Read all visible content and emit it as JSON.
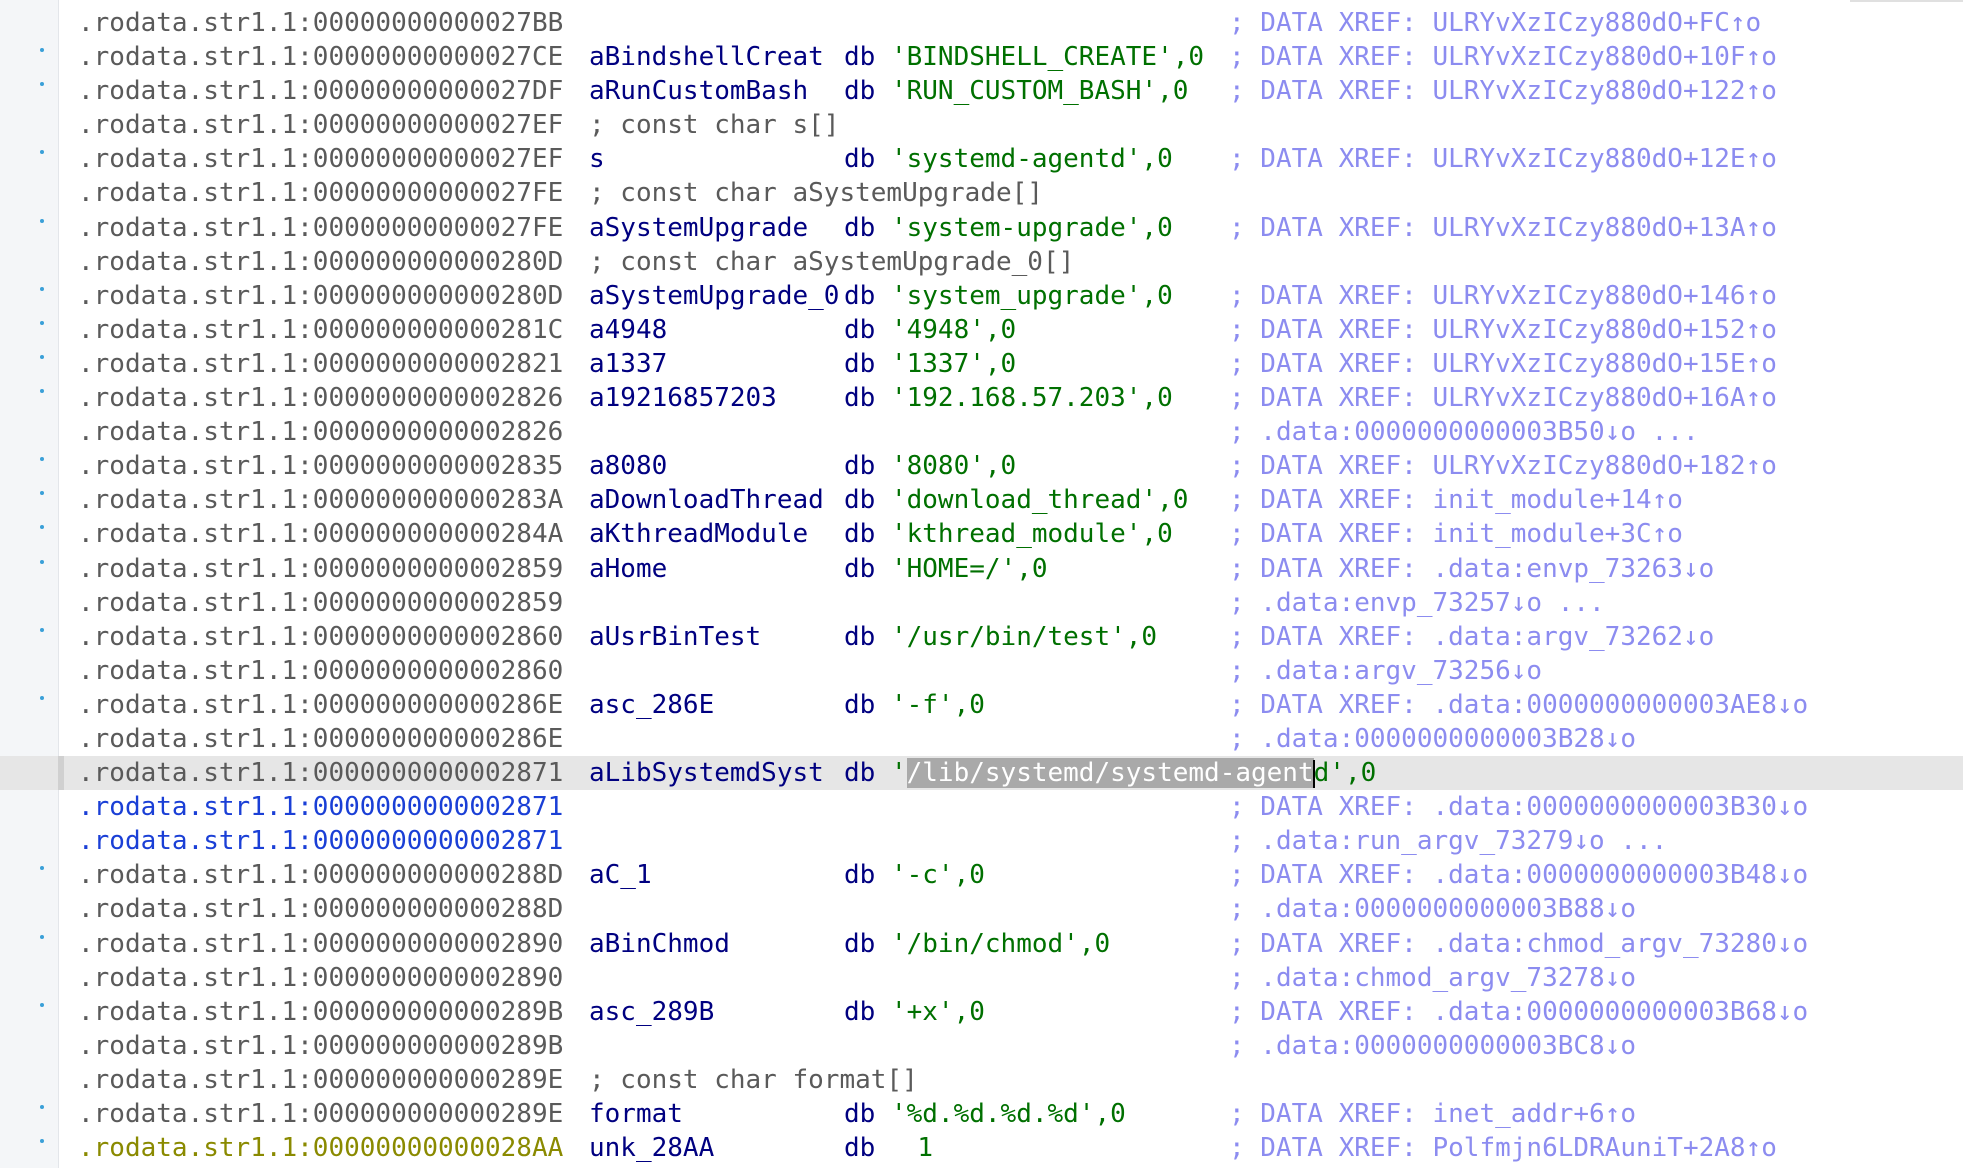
{
  "lines": [
    {
      "dot": false,
      "seg": ".rodata.str1.1:00000000000027BB",
      "segStyle": "",
      "name": "",
      "op": "",
      "str": "",
      "tail": "",
      "cmt": "; DATA XREF: ULRYvXzICzy880dO+FC↑o"
    },
    {
      "dot": true,
      "seg": ".rodata.str1.1:00000000000027CE",
      "segStyle": "",
      "name": "aBindshellCreat",
      "op": "db ",
      "str": "'BINDSHELL_CREATE'",
      "tail": ",0",
      "cmt": "; DATA XREF: ULRYvXzICzy880dO+10F↑o"
    },
    {
      "dot": true,
      "seg": ".rodata.str1.1:00000000000027DF",
      "segStyle": "",
      "name": "aRunCustomBash",
      "op": "db ",
      "str": "'RUN_CUSTOM_BASH'",
      "tail": ",0",
      "cmt": "; DATA XREF: ULRYvXzICzy880dO+122↑o"
    },
    {
      "dot": false,
      "seg": ".rodata.str1.1:00000000000027EF",
      "segStyle": "",
      "name": "; const char s[]",
      "nameComment": true,
      "op": "",
      "str": "",
      "tail": "",
      "cmt": ""
    },
    {
      "dot": true,
      "seg": ".rodata.str1.1:00000000000027EF",
      "segStyle": "",
      "name": "s",
      "op": "db ",
      "str": "'systemd-agentd'",
      "tail": ",0",
      "cmt": "; DATA XREF: ULRYvXzICzy880dO+12E↑o"
    },
    {
      "dot": false,
      "seg": ".rodata.str1.1:00000000000027FE",
      "segStyle": "",
      "name": "; const char aSystemUpgrade[]",
      "nameComment": true,
      "op": "",
      "str": "",
      "tail": "",
      "cmt": ""
    },
    {
      "dot": true,
      "seg": ".rodata.str1.1:00000000000027FE",
      "segStyle": "",
      "name": "aSystemUpgrade",
      "op": "db ",
      "str": "'system-upgrade'",
      "tail": ",0",
      "cmt": "; DATA XREF: ULRYvXzICzy880dO+13A↑o"
    },
    {
      "dot": false,
      "seg": ".rodata.str1.1:000000000000280D",
      "segStyle": "",
      "name": "; const char aSystemUpgrade_0[]",
      "nameComment": true,
      "op": "",
      "str": "",
      "tail": "",
      "cmt": ""
    },
    {
      "dot": true,
      "seg": ".rodata.str1.1:000000000000280D",
      "segStyle": "",
      "name": "aSystemUpgrade_0",
      "op": "db ",
      "str": "'system_upgrade'",
      "tail": ",0",
      "cmt": "; DATA XREF: ULRYvXzICzy880dO+146↑o"
    },
    {
      "dot": true,
      "seg": ".rodata.str1.1:000000000000281C",
      "segStyle": "",
      "name": "a4948",
      "op": "db ",
      "str": "'4948'",
      "tail": ",0",
      "cmt": "; DATA XREF: ULRYvXzICzy880dO+152↑o"
    },
    {
      "dot": true,
      "seg": ".rodata.str1.1:0000000000002821",
      "segStyle": "",
      "name": "a1337",
      "op": "db ",
      "str": "'1337'",
      "tail": ",0",
      "cmt": "; DATA XREF: ULRYvXzICzy880dO+15E↑o"
    },
    {
      "dot": true,
      "seg": ".rodata.str1.1:0000000000002826",
      "segStyle": "",
      "name": "a19216857203",
      "op": "db ",
      "str": "'192.168.57.203'",
      "tail": ",0",
      "cmt": "; DATA XREF: ULRYvXzICzy880dO+16A↑o"
    },
    {
      "dot": false,
      "seg": ".rodata.str1.1:0000000000002826",
      "segStyle": "",
      "name": "",
      "op": "",
      "str": "",
      "tail": "",
      "cmt": "; .data:0000000000003B50↓o ..."
    },
    {
      "dot": true,
      "seg": ".rodata.str1.1:0000000000002835",
      "segStyle": "",
      "name": "a8080",
      "op": "db ",
      "str": "'8080'",
      "tail": ",0",
      "cmt": "; DATA XREF: ULRYvXzICzy880dO+182↑o"
    },
    {
      "dot": true,
      "seg": ".rodata.str1.1:000000000000283A",
      "segStyle": "",
      "name": "aDownloadThread",
      "op": "db ",
      "str": "'download_thread'",
      "tail": ",0",
      "cmt": "; DATA XREF: init_module+14↑o"
    },
    {
      "dot": true,
      "seg": ".rodata.str1.1:000000000000284A",
      "segStyle": "",
      "name": "aKthreadModule",
      "op": "db ",
      "str": "'kthread_module'",
      "tail": ",0",
      "cmt": "; DATA XREF: init_module+3C↑o"
    },
    {
      "dot": true,
      "seg": ".rodata.str1.1:0000000000002859",
      "segStyle": "",
      "name": "aHome",
      "op": "db ",
      "str": "'HOME=/'",
      "tail": ",0",
      "cmt": "; DATA XREF: .data:envp_73263↓o"
    },
    {
      "dot": false,
      "seg": ".rodata.str1.1:0000000000002859",
      "segStyle": "",
      "name": "",
      "op": "",
      "str": "",
      "tail": "",
      "cmt": "; .data:envp_73257↓o ..."
    },
    {
      "dot": true,
      "seg": ".rodata.str1.1:0000000000002860",
      "segStyle": "",
      "name": "aUsrBinTest",
      "op": "db ",
      "str": "'/usr/bin/test'",
      "tail": ",0",
      "cmt": "; DATA XREF: .data:argv_73262↓o"
    },
    {
      "dot": false,
      "seg": ".rodata.str1.1:0000000000002860",
      "segStyle": "",
      "name": "",
      "op": "",
      "str": "",
      "tail": "",
      "cmt": "; .data:argv_73256↓o"
    },
    {
      "dot": true,
      "seg": ".rodata.str1.1:000000000000286E",
      "segStyle": "",
      "name": "asc_286E",
      "op": "db ",
      "str": "'-f'",
      "tail": ",0",
      "cmt": "; DATA XREF: .data:0000000000003AE8↓o"
    },
    {
      "dot": false,
      "seg": ".rodata.str1.1:000000000000286E",
      "segStyle": "",
      "name": "",
      "op": "",
      "str": "",
      "tail": "",
      "cmt": "; .data:0000000000003B28↓o"
    },
    {
      "dot": false,
      "selected": true,
      "seg": ".rodata.str1.1:0000000000002871",
      "segStyle": "",
      "name": "aLibSystemdSyst",
      "op": "db ",
      "str": "'/lib/systemd/systemd-agentd'",
      "tail": ",0",
      "cmt": ""
    },
    {
      "dot": false,
      "seg": ".rodata.str1.1:0000000000002871",
      "segStyle": "blue",
      "name": "",
      "op": "",
      "str": "",
      "tail": "",
      "cmt": "; DATA XREF: .data:0000000000003B30↓o"
    },
    {
      "dot": false,
      "seg": ".rodata.str1.1:0000000000002871",
      "segStyle": "blue",
      "name": "",
      "op": "",
      "str": "",
      "tail": "",
      "cmt": "; .data:run_argv_73279↓o ..."
    },
    {
      "dot": true,
      "seg": ".rodata.str1.1:000000000000288D",
      "segStyle": "",
      "name": "aC_1",
      "op": "db ",
      "str": "'-c'",
      "tail": ",0",
      "cmt": "; DATA XREF: .data:0000000000003B48↓o"
    },
    {
      "dot": false,
      "seg": ".rodata.str1.1:000000000000288D",
      "segStyle": "",
      "name": "",
      "op": "",
      "str": "",
      "tail": "",
      "cmt": "; .data:0000000000003B88↓o"
    },
    {
      "dot": true,
      "seg": ".rodata.str1.1:0000000000002890",
      "segStyle": "",
      "name": "aBinChmod",
      "op": "db ",
      "str": "'/bin/chmod'",
      "tail": ",0",
      "cmt": "; DATA XREF: .data:chmod_argv_73280↓o"
    },
    {
      "dot": false,
      "seg": ".rodata.str1.1:0000000000002890",
      "segStyle": "",
      "name": "",
      "op": "",
      "str": "",
      "tail": "",
      "cmt": "; .data:chmod_argv_73278↓o"
    },
    {
      "dot": true,
      "seg": ".rodata.str1.1:000000000000289B",
      "segStyle": "",
      "name": "asc_289B",
      "op": "db ",
      "str": "'+x'",
      "tail": ",0",
      "cmt": "; DATA XREF: .data:0000000000003B68↓o"
    },
    {
      "dot": false,
      "seg": ".rodata.str1.1:000000000000289B",
      "segStyle": "",
      "name": "",
      "op": "",
      "str": "",
      "tail": "",
      "cmt": "; .data:0000000000003BC8↓o"
    },
    {
      "dot": false,
      "seg": ".rodata.str1.1:000000000000289E",
      "segStyle": "",
      "name": "; const char format[]",
      "nameComment": true,
      "op": "",
      "str": "",
      "tail": "",
      "cmt": ""
    },
    {
      "dot": true,
      "seg": ".rodata.str1.1:000000000000289E",
      "segStyle": "",
      "name": "format",
      "op": "db ",
      "str": "'%d.%d.%d.%d'",
      "tail": ",0",
      "cmt": "; DATA XREF: inet_addr+6↑o"
    },
    {
      "dot": true,
      "seg": ".rodata.str1.1:00000000000028AA",
      "segStyle": "olive",
      "name": "unk_28AA",
      "op": "db",
      "numOnly": "1",
      "str": "",
      "tail": "",
      "cmt": "; DATA XREF: Polfmjn6LDRAuniT+2A8↑o"
    }
  ],
  "selection": {
    "line": 22,
    "highlight": "/lib/systemd/systemd-agent",
    "after_caret": "d"
  }
}
